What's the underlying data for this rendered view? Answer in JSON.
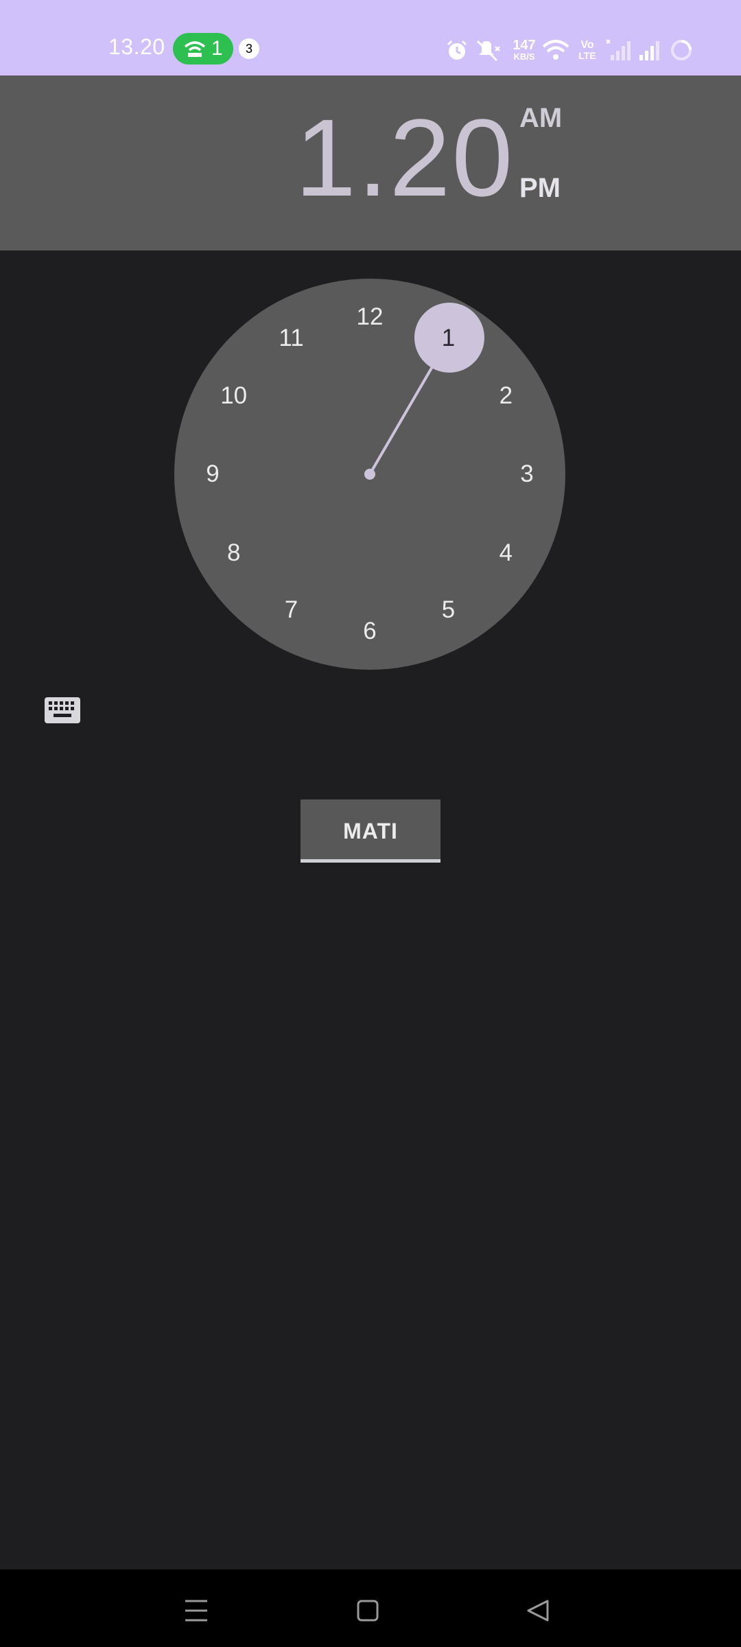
{
  "status_bar": {
    "time": "13.20",
    "hotspot_count": "1",
    "notification_count": "3",
    "net_speed_value": "147",
    "net_speed_unit": "KB/S",
    "volte_top": "Vo",
    "volte_bottom": "LTE",
    "icons": [
      "alarm-icon",
      "mute-icon",
      "wifi-icon",
      "signal-icon",
      "signal-icon",
      "battery-loading-icon"
    ],
    "bg_color": "#d1c1fb"
  },
  "header": {
    "time": "1.20",
    "am_label": "AM",
    "pm_label": "PM",
    "selected_period": "PM"
  },
  "dial": {
    "numbers": [
      "12",
      "1",
      "2",
      "3",
      "4",
      "5",
      "6",
      "7",
      "8",
      "9",
      "10",
      "11"
    ],
    "selected": "1",
    "accent_color": "#cdc4dc"
  },
  "keyboard_toggle": {
    "icon": "keyboard-icon"
  },
  "cancel_button": {
    "label": "MATI"
  },
  "nav_bar": {
    "icons": [
      "menu-icon",
      "home-icon",
      "back-icon"
    ]
  }
}
